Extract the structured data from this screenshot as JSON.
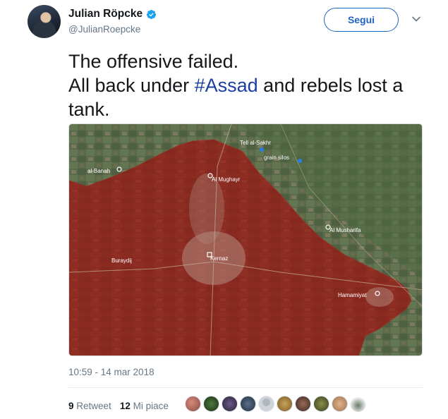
{
  "author": {
    "name": "Julian Röpcke",
    "handle": "@JulianRoepcke",
    "verified": true
  },
  "actions": {
    "follow_label": "Segui",
    "more_icon": "chevron-down-icon"
  },
  "tweet": {
    "line1": "The offensive failed.",
    "line2_before": "All back under ",
    "hashtag": "#Assad",
    "line2_after": " and rebels lost a",
    "line3": "tank.",
    "timestamp": "10:59 - 14 mar 2018"
  },
  "map": {
    "labels": [
      "Tell al-Sakhr",
      "grain silos",
      "al-Banah",
      "Al Mughayr",
      "Al Musharifa",
      "Buraydij",
      "Kernaz",
      "Hamamiyat"
    ],
    "overlay_color": "#8b1f1a"
  },
  "engagement": {
    "retweet_count": "9",
    "retweet_label": "Retweet",
    "like_count": "12",
    "like_label": "Mi piace"
  },
  "colors": {
    "accent": "#1d64c8",
    "hashtag": "#1b3fa0",
    "muted": "#657786"
  }
}
